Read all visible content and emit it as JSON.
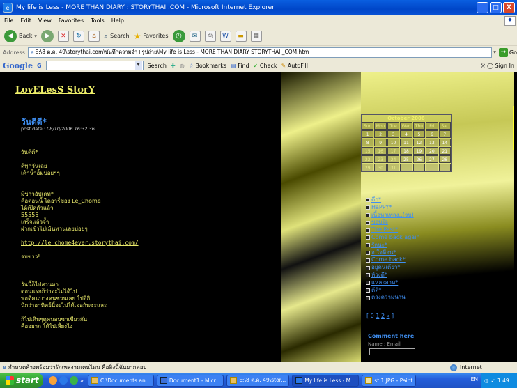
{
  "window": {
    "title": "My life is Less - MORE THAN DIARY : STORYTHAI .COM - Microsoft Internet Explorer",
    "min": "_",
    "max": "□",
    "close": "X"
  },
  "menu": [
    "File",
    "Edit",
    "View",
    "Favorites",
    "Tools",
    "Help"
  ],
  "toolbar": {
    "back": "Back",
    "search": "Search",
    "favorites": "Favorites"
  },
  "address": {
    "label": "Address",
    "value": "E:\\8 ต.ค. 49\\storythai.com\\บันทึกความจำ+รูปถ่าย\\My life is Less - MORE THAN DIARY  STORYTHAI _COM.htm",
    "go": "Go"
  },
  "googlebar": {
    "logo": "Google",
    "g": "G",
    "search": "Search",
    "bookmarks": "Bookmarks",
    "find": "Find",
    "check": "Check",
    "autofill": "AutoFill",
    "signin": "Sign In"
  },
  "page": {
    "blog_title": "LovELesS StorY",
    "post_title": "วันดีดี*",
    "post_date_label": "post date :",
    "post_date_value": "08/10/2006 16:32:36",
    "body_lines": [
      "วันดีดี*",
      "",
      "ดีทุกวันเลย",
      "เค้าน้ำอิ้มบ่อยๆๆ",
      "",
      "",
      "มีข่าวอัปเดท*",
      "คือตอนนี้ ไดอารี่ของ Le_Chome",
      "ได้เปิดตัวแล้ว",
      "55555",
      "เสร็จแล้วจ้ำ",
      "ฝากเข้าไปเม้นทานเลยบ่อยๆ",
      "",
      "http://le_chome4ever.storythai.com/",
      "",
      "จบข่าว!",
      "",
      "............................................",
      "",
      "วันนี้ก็ไปสวนมา",
      "ตอนแรกก็ว่าจะไม่ได้ไป",
      "พอดีคนบางคนชวนเลย ไปอีอิ",
      "นึกว่าอาทิตย์นี้จะไม่ได้เจอกันซะและ",
      "",
      "ก็ไปเดินๆดูคนอบซาเขียวกัน",
      "คืออยาก ได้ไปเลี้ยงไง"
    ],
    "link_index": 13
  },
  "calendar": {
    "title": "October 2006",
    "days": [
      "Sun",
      "Mon",
      "Tue",
      "Wed",
      "Thu",
      "Fri",
      "Sat"
    ],
    "weeks": [
      [
        "1",
        "2",
        "3",
        "4",
        "5",
        "6",
        "7"
      ],
      [
        "8",
        "9",
        "10",
        "11",
        "12",
        "13",
        "14"
      ],
      [
        "15",
        "16",
        "17",
        "18",
        "19",
        "20",
        "21"
      ],
      [
        "22",
        "23",
        "24",
        "25",
        "26",
        "27",
        "28"
      ],
      [
        "29",
        "30",
        "31",
        "",
        "",
        "",
        ""
      ]
    ]
  },
  "categories": [
    "ดีก*",
    "HaPPY*",
    "เนื้อหาเพลง..(จบ)",
    "ขอบใจ",
    "The Past*",
    "Come back again",
    "รักนะ*",
    "อ ใจดีอน*",
    "Come back*",
    "อยู่คนเดียว*",
    "ห้วงดี*",
    "แหละสาห*",
    "ดีดี*",
    "ดวงความนาน"
  ],
  "pager": {
    "open": "[",
    "p0": "0",
    "p1": "1",
    "next": "2",
    "more": "»",
    "close": "]"
  },
  "comment": {
    "title": "Comment here",
    "sub": "Name : Email"
  },
  "status": {
    "text": "กำหนดค้างพร้อมว่ารักเพลงามเคนไหน คือสิ่งนี้ฉันยากตอบ",
    "zone": "Internet"
  },
  "taskbar": {
    "start": "start",
    "tasks": [
      "C:\\Documents an...",
      "Document1 - Micr...",
      "E:\\8 ต.ค. 49\\stor...",
      "My life is Less - M...",
      "st 1.JPG - Paint"
    ],
    "lang": "EN",
    "time": "1:49"
  }
}
